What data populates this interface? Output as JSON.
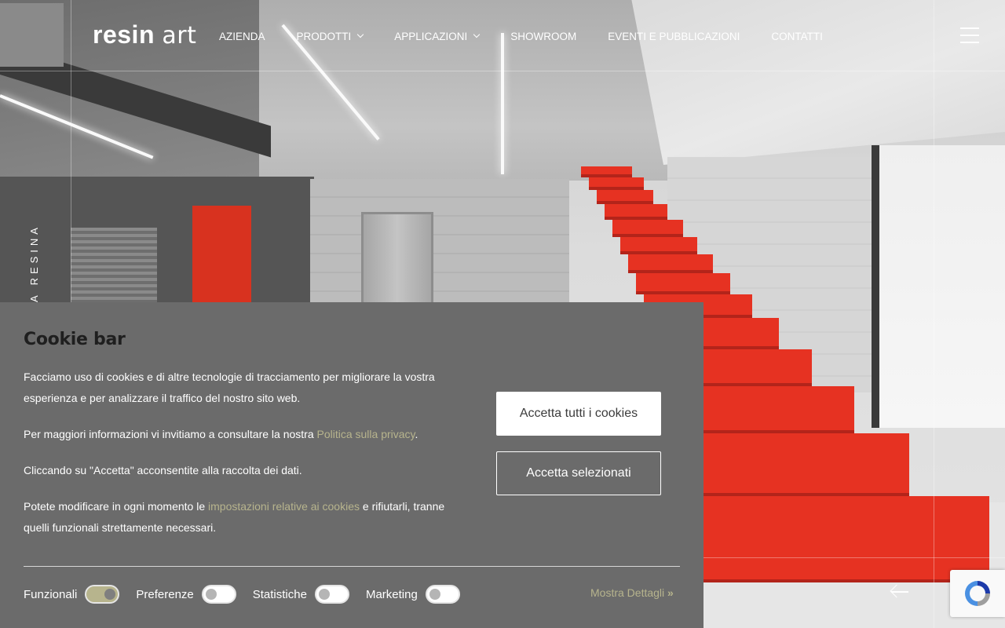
{
  "header": {
    "logo_bold": "resin",
    "logo_light": "art",
    "nav": [
      {
        "label": "AZIENDA",
        "dropdown": false
      },
      {
        "label": "PRODOTTI",
        "dropdown": true
      },
      {
        "label": "APPLICAZIONI",
        "dropdown": true
      },
      {
        "label": "SHOWROOM",
        "dropdown": false
      },
      {
        "label": "EVENTI E PUBBLICAZIONI",
        "dropdown": false
      },
      {
        "label": "CONTATTI",
        "dropdown": false
      }
    ],
    "menu_icon": "hamburger-icon"
  },
  "hero": {
    "vertical_text": "A RESINA"
  },
  "cookie_bar": {
    "title": "Cookie bar",
    "p1": "Facciamo uso di cookies e di altre tecnologie di tracciamento per migliorare la vostra esperienza e per analizzare il traffico del nostro sito web.",
    "p2_before": "Per maggiori informazioni vi invitiamo a consultare la nostra ",
    "p2_link": "Politica sulla privacy",
    "p2_after": ".",
    "p3": "Cliccando su \"Accetta\" acconsentite alla raccolta dei dati.",
    "p4_before": "Potete modificare in ogni momento le ",
    "p4_link": "impostazioni relative ai cookies",
    "p4_after": " e rifiutarli, tranne quelli funzionali strettamente necessari.",
    "accept_all": "Accetta tutti i cookies",
    "accept_selected": "Accetta selezionati",
    "toggles": [
      {
        "label": "Funzionali",
        "on": true
      },
      {
        "label": "Preferenze",
        "on": false
      },
      {
        "label": "Statistiche",
        "on": false
      },
      {
        "label": "Marketing",
        "on": false
      }
    ],
    "details": "Mostra Dettagli",
    "details_icon": "double-chevron-right-icon"
  },
  "slider": {
    "prev_icon": "arrow-left-icon"
  },
  "recaptcha_icon": "recaptcha-icon",
  "colors": {
    "accent": "#b7b48d",
    "cookie_bg": "#6b6b6b",
    "stair_red": "#e63222"
  }
}
